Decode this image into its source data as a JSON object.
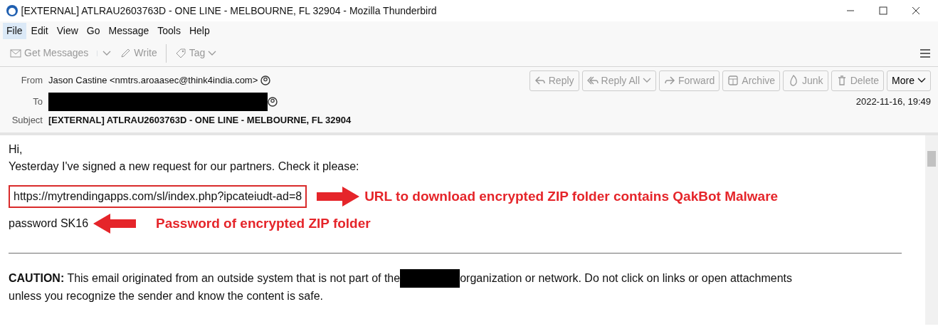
{
  "window": {
    "title": "[EXTERNAL] ATLRAU2603763D - ONE LINE - MELBOURNE, FL 32904 - Mozilla Thunderbird"
  },
  "menu": [
    {
      "label": "File",
      "selected": true
    },
    {
      "label": "Edit",
      "selected": false
    },
    {
      "label": "View",
      "selected": false
    },
    {
      "label": "Go",
      "selected": false
    },
    {
      "label": "Message",
      "selected": false
    },
    {
      "label": "Tools",
      "selected": false
    },
    {
      "label": "Help",
      "selected": false
    }
  ],
  "toolbar": [
    {
      "kind": "get",
      "label": "Get Messages",
      "disabled": true
    },
    {
      "kind": "write",
      "label": "Write",
      "disabled": true
    },
    {
      "kind": "tag",
      "label": "Tag",
      "disabled": true
    }
  ],
  "header": {
    "from_label": "From",
    "from": "Jason Castine <nmtrs.aroaasec@think4india.com>",
    "to_label": "To",
    "subject_label": "Subject",
    "subject": "[EXTERNAL] ATLRAU2603763D - ONE LINE - MELBOURNE, FL 32904",
    "date": "2022-11-16, 19:49",
    "actions": [
      {
        "kind": "reply",
        "label": "Reply",
        "disabled": true
      },
      {
        "kind": "replyall",
        "label": "Reply All",
        "disabled": true
      },
      {
        "kind": "forward",
        "label": "Forward",
        "disabled": true
      },
      {
        "kind": "archive",
        "label": "Archive",
        "disabled": true
      },
      {
        "kind": "junk",
        "label": "Junk",
        "disabled": true
      },
      {
        "kind": "delete",
        "label": "Delete",
        "disabled": true
      },
      {
        "kind": "more",
        "label": "More",
        "disabled": false
      }
    ]
  },
  "body": {
    "greeting": "Hi,",
    "line": "Yesterday I've signed a new request for our partners. Check it please:",
    "url": "https://mytrendingapps.com/sl/index.php?ipcateiudt-ad=8",
    "password": "password SK16",
    "caution_before": "**CAUTION:** This email originated from an outside system that is not part of the",
    "caution_after": "organization or network. Do not click on links or open attachments",
    "caution_end": "unless you recognize the sender and know the content is safe."
  },
  "annotations": [
    {
      "kind": "right",
      "text": "URL to download encrypted ZIP folder contains QakBot Malware"
    },
    {
      "kind": "left",
      "text": "Password of encrypted ZIP folder"
    }
  ]
}
